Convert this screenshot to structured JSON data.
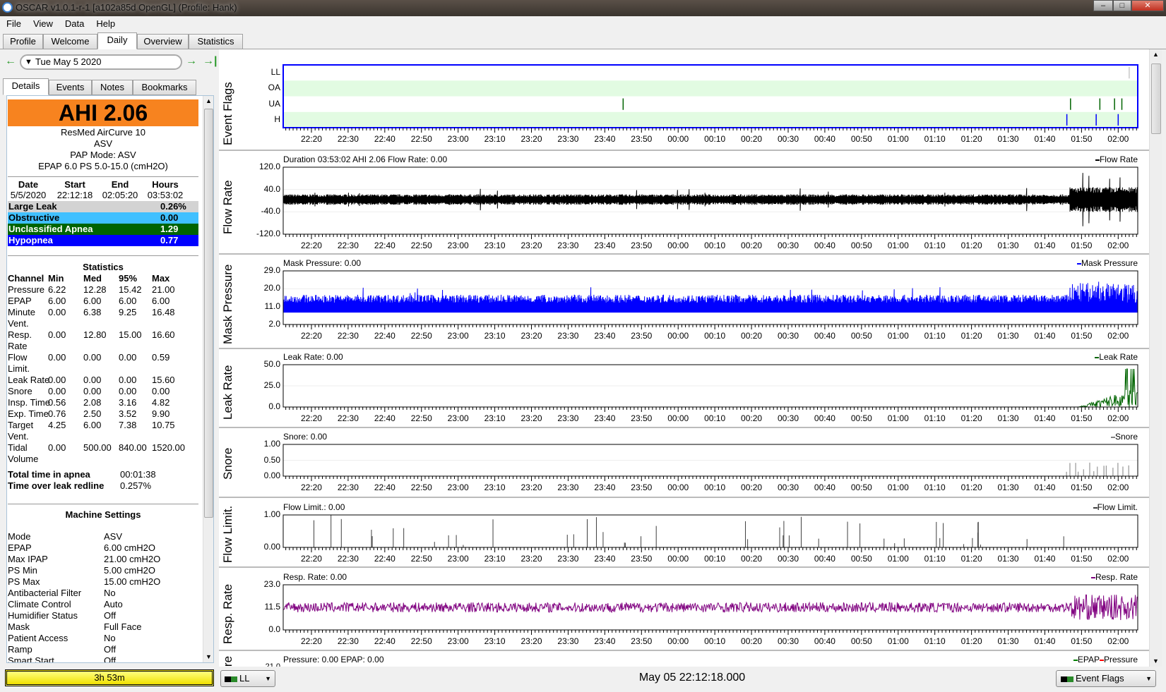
{
  "window": {
    "title": "OSCAR v1.0.1-r-1 [a102a85d OpenGL] (Profile: Hank)"
  },
  "menu": [
    "File",
    "View",
    "Data",
    "Help"
  ],
  "tabs": [
    "Profile",
    "Welcome",
    "Daily",
    "Overview",
    "Statistics"
  ],
  "active_tab": "Daily",
  "date_nav": {
    "date": "Tue May 5 2020",
    "prev_icon": "arrow-left-icon",
    "next_icon": "arrow-right-icon",
    "last_icon": "arrow-to-end-icon"
  },
  "subtabs": [
    "Details",
    "Events",
    "Notes",
    "Bookmarks"
  ],
  "details": {
    "ahi": "AHI 2.06",
    "machine": [
      "ResMed AirCurve 10",
      "ASV",
      "PAP Mode: ASV",
      "EPAP 6.0 PS 5.0-15.0 (cmH2O)"
    ],
    "session_headers": [
      "Date",
      "Start",
      "End",
      "Hours"
    ],
    "session_values": [
      "5/5/2020",
      "22:12:18",
      "02:05:20",
      "03:53:02"
    ],
    "indices": [
      {
        "label": "Large Leak",
        "value": "0.26%",
        "bg": "#d3d3d3",
        "fg": "#000000"
      },
      {
        "label": "Obstructive",
        "value": "0.00",
        "bg": "#40c0ff",
        "fg": "#000000"
      },
      {
        "label": "Unclassified Apnea",
        "value": "1.29",
        "bg": "#006400",
        "fg": "#ffffff"
      },
      {
        "label": "Hypopnea",
        "value": "0.77",
        "bg": "#0000ff",
        "fg": "#ffffff"
      }
    ],
    "stats_title": "Statistics",
    "stats_headers": [
      "Channel",
      "Min",
      "Med",
      "95%",
      "Max"
    ],
    "stats": [
      [
        "Pressure",
        "6.22",
        "12.28",
        "15.42",
        "21.00"
      ],
      [
        "EPAP",
        "6.00",
        "6.00",
        "6.00",
        "6.00"
      ],
      [
        "Minute Vent.",
        "0.00",
        "6.38",
        "9.25",
        "16.48"
      ],
      [
        "Resp. Rate",
        "0.00",
        "12.80",
        "15.00",
        "16.60"
      ],
      [
        "Flow Limit.",
        "0.00",
        "0.00",
        "0.00",
        "0.59"
      ],
      [
        "Leak Rate",
        "0.00",
        "0.00",
        "0.00",
        "15.60"
      ],
      [
        "Snore",
        "0.00",
        "0.00",
        "0.00",
        "0.00"
      ],
      [
        "Insp. Time",
        "0.56",
        "2.08",
        "3.16",
        "4.82"
      ],
      [
        "Exp. Time",
        "0.76",
        "2.50",
        "3.52",
        "9.90"
      ],
      [
        "Target Vent.",
        "4.25",
        "6.00",
        "7.38",
        "10.75"
      ],
      [
        "Tidal Volume",
        "0.00",
        "500.00",
        "840.00",
        "1520.00"
      ]
    ],
    "totals": [
      [
        "Total time in apnea",
        "00:01:38"
      ],
      [
        "Time over leak redline",
        "0.257%"
      ]
    ],
    "settings_title": "Machine Settings",
    "settings": [
      [
        "Mode",
        "ASV"
      ],
      [
        "EPAP",
        "6.00 cmH2O"
      ],
      [
        "Max IPAP",
        "21.00 cmH2O"
      ],
      [
        "PS Min",
        "5.00 cmH2O"
      ],
      [
        "PS Max",
        "15.00 cmH2O"
      ],
      [
        "Antibacterial Filter",
        "No"
      ],
      [
        "Climate Control",
        "Auto"
      ],
      [
        "Humidifier Status",
        "Off"
      ],
      [
        "Mask",
        "Full Face"
      ],
      [
        "Patient Access",
        "No"
      ],
      [
        "Ramp",
        "Off"
      ],
      [
        "Smart Start",
        "Off"
      ]
    ],
    "duration": "3h 53m"
  },
  "time_axis": {
    "start": "22:12:18",
    "end": "02:05:20",
    "ticks": [
      "22:20",
      "22:30",
      "22:40",
      "22:50",
      "23:00",
      "23:10",
      "23:20",
      "23:30",
      "23:40",
      "23:50",
      "00:00",
      "00:10",
      "00:20",
      "00:30",
      "00:40",
      "00:50",
      "01:00",
      "01:10",
      "01:20",
      "01:30",
      "01:40",
      "01:50",
      "02:00"
    ]
  },
  "charts": [
    {
      "name": "Event Flags",
      "title": "",
      "legend": "",
      "flags": [
        "LL",
        "OA",
        "UA",
        "H"
      ],
      "events": {
        "LL": [
          {
            "t": "02:03",
            "color": "#c8c8c8"
          }
        ],
        "UA": [
          {
            "t": "23:45"
          },
          {
            "t": "01:47"
          },
          {
            "t": "01:55"
          },
          {
            "t": "01:59"
          },
          {
            "t": "02:01"
          }
        ],
        "H": [
          {
            "t": "01:46"
          },
          {
            "t": "01:54"
          },
          {
            "t": "02:00"
          }
        ]
      },
      "colors": {
        "UA": "#006400",
        "H": "#0000ff",
        "band": "#e2fbe2",
        "frame": "#0000ff"
      }
    },
    {
      "name": "Flow Rate",
      "title": "Duration 03:53:02 AHI 2.06 Flow Rate: 0.00",
      "legend": "Flow Rate",
      "legend_color": "#000000",
      "yticks": [
        "120.0",
        "40.0",
        "-40.0",
        "-120.0"
      ],
      "ylim": [
        -120,
        120
      ],
      "color": "#000000"
    },
    {
      "name": "Mask Pressure",
      "title": "Mask Pressure: 0.00",
      "legend": "Mask Pressure",
      "legend_color": "#0000ff",
      "yticks": [
        "29.0",
        "20.0",
        "11.0",
        "2.0"
      ],
      "ylim": [
        2,
        29
      ],
      "color": "#0000ff"
    },
    {
      "name": "Leak Rate",
      "title": "Leak Rate: 0.00",
      "legend": "Leak Rate",
      "legend_color": "#006400",
      "yticks": [
        "50.0",
        "25.0",
        "0.0"
      ],
      "ylim": [
        0,
        50
      ],
      "color": "#006400"
    },
    {
      "name": "Snore",
      "title": "Snore: 0.00",
      "legend": "Snore",
      "legend_color": "#808080",
      "yticks": [
        "1.00",
        "0.50",
        "0.00"
      ],
      "ylim": [
        0,
        1
      ],
      "color": "#808080"
    },
    {
      "name": "Flow Limit.",
      "title": "Flow Limit.: 0.00",
      "legend": "Flow Limit.",
      "legend_color": "#404040",
      "yticks": [
        "1.00",
        "0.00"
      ],
      "ylim": [
        0,
        1
      ],
      "color": "#404040"
    },
    {
      "name": "Resp. Rate",
      "title": "Resp. Rate: 0.00",
      "legend": "Resp. Rate",
      "legend_color": "#800080",
      "yticks": [
        "23.0",
        "11.5",
        "0.0"
      ],
      "ylim": [
        0,
        23
      ],
      "color": "#800080"
    },
    {
      "name": "Pressure",
      "title": "Pressure: 0.00 EPAP: 0.00",
      "legend": "EPAP",
      "legend_color": "#008000",
      "legend2": "Pressure",
      "legend2_color": "#ff0000",
      "yticks": [
        "21.0"
      ]
    }
  ],
  "bottom": {
    "left_combo": "LL",
    "center_time": "May 05 22:12:18.000",
    "right_combo": "Event Flags"
  }
}
